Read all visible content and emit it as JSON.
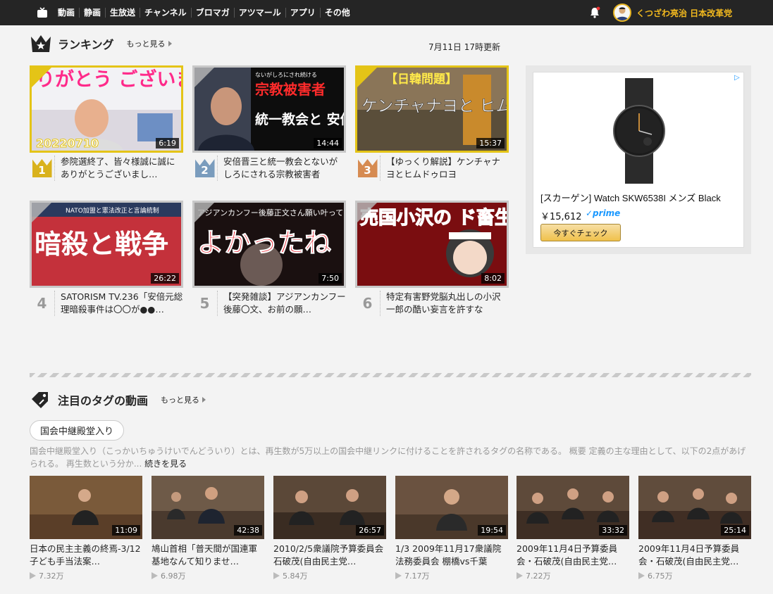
{
  "nav": [
    "動画",
    "静画",
    "生放送",
    "チャンネル",
    "ブロマガ",
    "アツマール",
    "アプリ",
    "その他"
  ],
  "user": {
    "name": "くつざわ亮治 日本改革党"
  },
  "ranking": {
    "title": "ランキング",
    "more": "もっと見る",
    "updated": "7月11日 17時更新",
    "items": [
      {
        "rank": "1",
        "title": "参院選終了、皆々様誠に誠にありがとうございまし…",
        "duration": "6:19",
        "thumb_text": "りがとう ございました！",
        "thumb_sub": "20220710",
        "crown": "#d9b21c"
      },
      {
        "rank": "2",
        "title": "安倍晋三と統一教会とないがしろにされる宗教被害者",
        "duration": "14:44",
        "thumb_text": "宗教被害者",
        "thumb_sub": "統一教会と 安倍晋三",
        "thumb_top": "ないがしろにされ続ける",
        "crown": "#7a9cbd"
      },
      {
        "rank": "3",
        "title": "【ゆっくり解説】ケンチャナヨとヒムドゥロヨ",
        "duration": "15:37",
        "thumb_text": "【日韓問題】",
        "thumb_sub": "ケンチャナヨと ヒムドゥロヨ",
        "crown": "#d68b52"
      },
      {
        "rank": "4",
        "title": "SATORISM TV.236「安倍元総理暗殺事件は〇〇が●●…",
        "duration": "26:22",
        "thumb_text": "暗殺と戦争",
        "thumb_top": "NATO加盟と憲法改正と言論統制"
      },
      {
        "rank": "5",
        "title": "【突発雑談】アジアンカンフー後藤〇文、お前の願…",
        "duration": "7:50",
        "thumb_text": "よかったね",
        "thumb_top": "アジアンカンフー後藤正文さん願い叶って"
      },
      {
        "rank": "6",
        "title": "特定有害野党脳丸出しの小沢一郎の酷い妄言を許すな",
        "duration": "8:02",
        "thumb_text": "売国小沢の ド畜生 発言"
      }
    ]
  },
  "ad": {
    "title": "[スカーゲン] Watch SKW6538I メンズ Black",
    "price": "￥15,612",
    "prime": "✓prime",
    "button": "今すぐチェック"
  },
  "tags": {
    "title": "注目のタグの動画",
    "more": "もっと見る",
    "tag": "国会中継殿堂入り",
    "description": "国会中継殿堂入り（こっかいちゅうけいでんどういり）とは、再生数が5万以上の国会中継リンクに付けることを許されるタグの名称である。 概要 定義の主な理由として、以下の2点があげられる。 再生数という分か...",
    "readmore": "続きを見る",
    "videos": [
      {
        "title": "日本の民主主義の終焉-3/12子ども手当法案…",
        "duration": "11:09",
        "views": "7.32万"
      },
      {
        "title": "鳩山首相「普天間が国連軍基地なんて知りませ…",
        "duration": "42:38",
        "views": "6.98万"
      },
      {
        "title": "2010/2/5衆議院予算委員会　石破茂(自由民主党…",
        "duration": "26:57",
        "views": "5.84万"
      },
      {
        "title": "1/3 2009年11月17衆議院法務委員会 棚橋vs千葉",
        "duration": "19:54",
        "views": "7.17万"
      },
      {
        "title": "2009年11月4日予算委員会・石破茂(自由民主党…",
        "duration": "33:32",
        "views": "7.22万"
      },
      {
        "title": "2009年11月4日予算委員会・石破茂(自由民主党…",
        "duration": "25:14",
        "views": "6.75万"
      }
    ]
  }
}
